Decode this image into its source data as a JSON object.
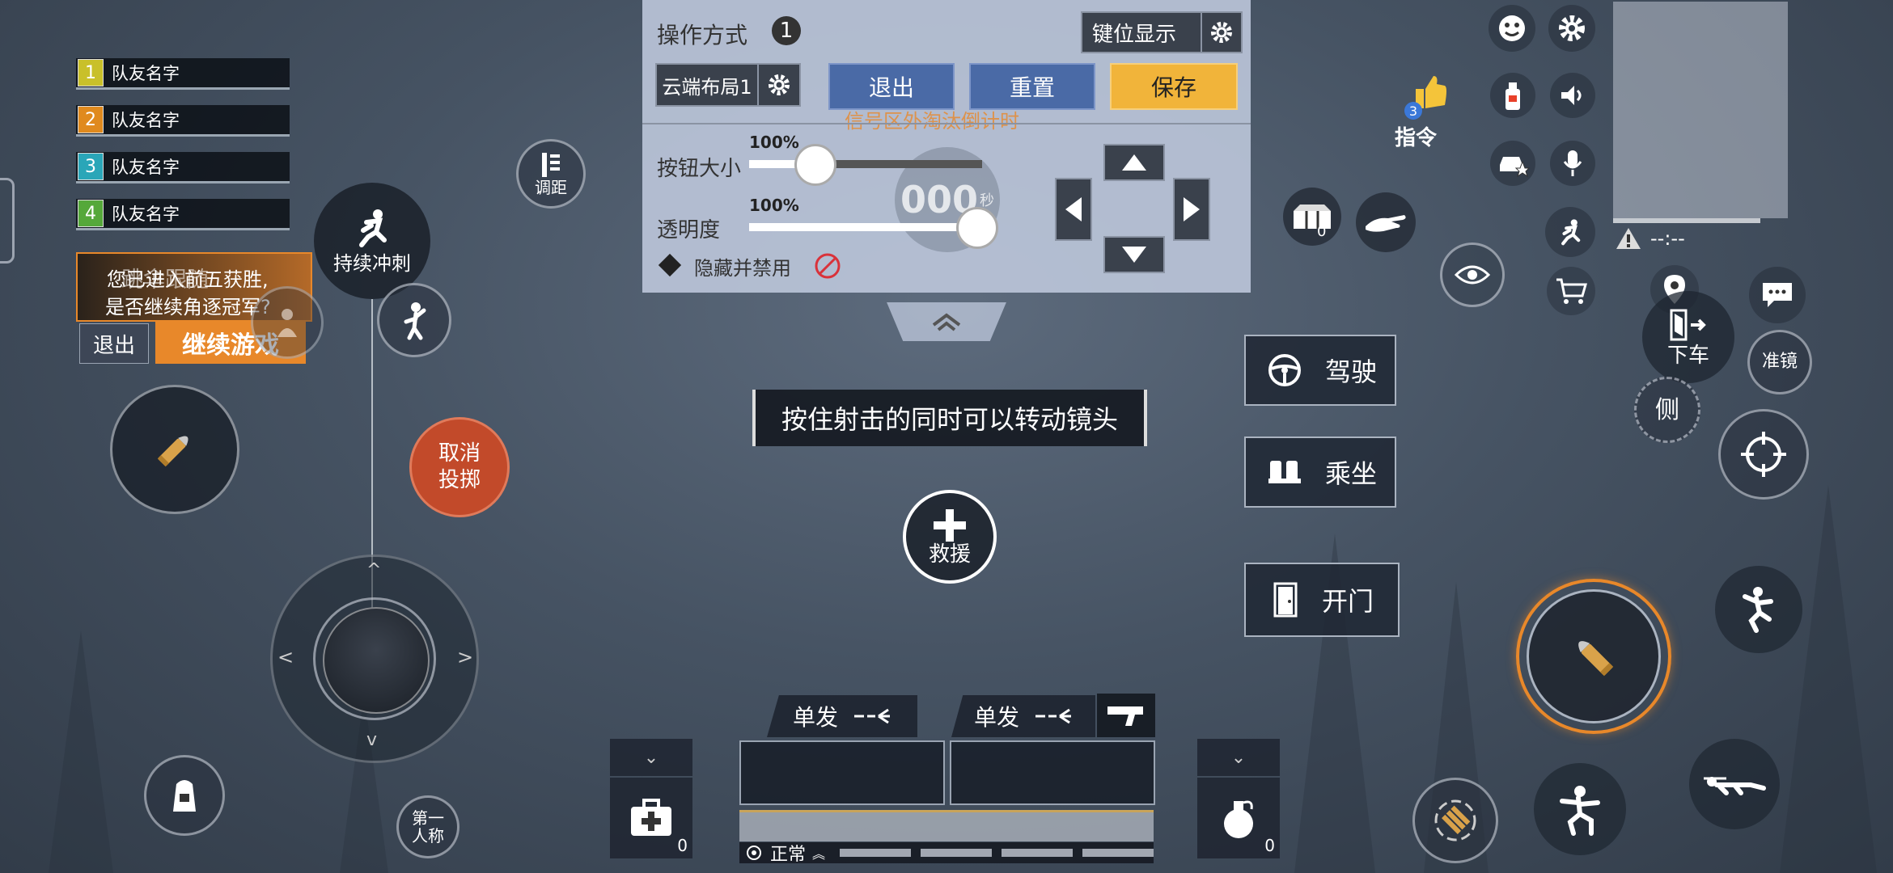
{
  "team": [
    {
      "num": "1",
      "name": "队友名字",
      "color": "#c9c02a"
    },
    {
      "num": "2",
      "name": "队友名字",
      "color": "#e08a1e"
    },
    {
      "num": "3",
      "name": "队友名字",
      "color": "#2aa6b8"
    },
    {
      "num": "4",
      "name": "队友名字",
      "color": "#55a83a"
    }
  ],
  "prompt": {
    "bg_text": "跳伞跟随",
    "line1": "您已进入前五获胜,",
    "line2": "是否继续角逐冠军?",
    "exit": "退出",
    "continue": "继续游戏"
  },
  "left": {
    "adjust_distance": "调距",
    "sprint": "持续冲刺",
    "cancel_throw_line1": "取消",
    "cancel_throw_line2": "投掷",
    "first_person_line1": "第一",
    "first_person_line2": "人称"
  },
  "editor": {
    "title": "操作方式",
    "badge": "1",
    "key_display": "键位显示",
    "cloud_layout": "云端布局1",
    "exit": "退出",
    "reset": "重置",
    "save": "保存",
    "signal_text": "信号区外淘汰倒计时",
    "button_size_label": "按钮大小",
    "button_size_value": "100%",
    "button_size": 1.0,
    "opacity_label": "透明度",
    "opacity_value": "100%",
    "opacity": 1.0,
    "hide_disable": "隐藏并禁用",
    "timer_digits": "000",
    "timer_unit": "秒"
  },
  "hint": "按住射击的同时可以转动镜头",
  "rescue": "救援",
  "vehicle": {
    "drive": "驾驶",
    "ride": "乘坐",
    "open_door": "开门"
  },
  "right": {
    "command": "指令",
    "command_badge": "3",
    "crate_count": "0",
    "exit_vehicle": "下车",
    "scope": "准镜",
    "lean": "侧",
    "minimap_status": "--:--"
  },
  "bottom": {
    "fire_mode_1": "单发",
    "fire_mode_2": "单发",
    "medkit_count": "0",
    "grenade_count": "0",
    "status": "正常"
  },
  "colors": {
    "save": "#f1b43a",
    "accent_orange": "#e8882a",
    "cancel_red": "#c24a2a",
    "panel_blue": "#4a6aa6"
  }
}
